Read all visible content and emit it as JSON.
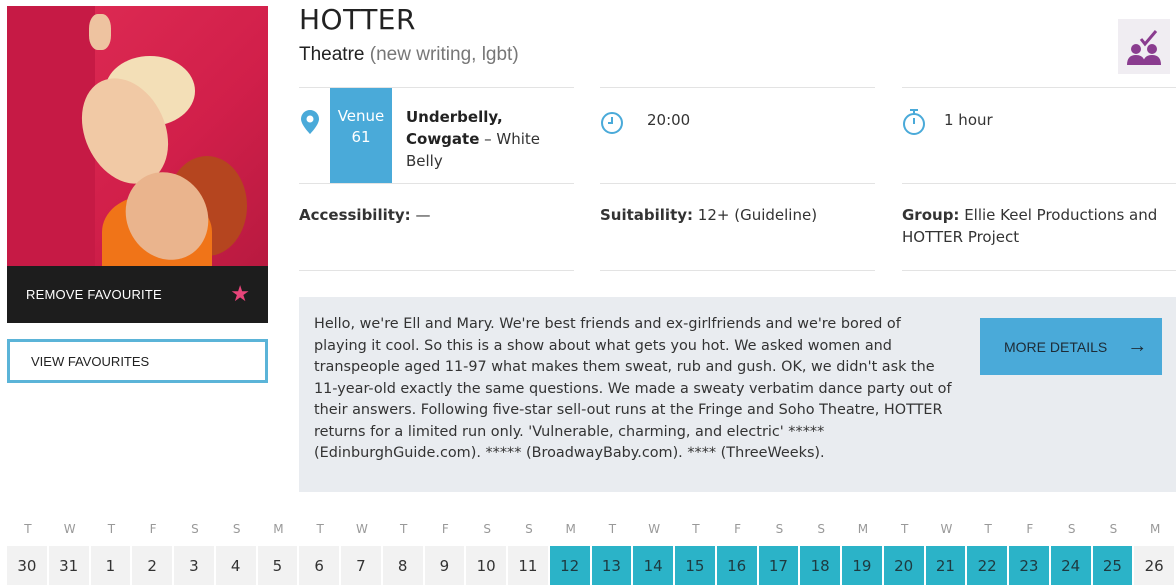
{
  "show": {
    "title": "HOTTER",
    "category": "Theatre",
    "genres": "(new writing, lgbt)"
  },
  "sidebar": {
    "remove_favourite_label": "REMOVE FAVOURITE",
    "view_favourites_label": "VIEW FAVOURITES"
  },
  "icons": {
    "location": "map-pin-icon",
    "time": "clock-icon",
    "duration": "stopwatch-icon",
    "favourite": "star-icon",
    "group": "group-check-icon",
    "more": "arrow-right-icon"
  },
  "venue": {
    "badge_line1": "Venue",
    "badge_line2": "61",
    "name_bold": "Underbelly, Cowgate",
    "name_rest": " – White Belly"
  },
  "time": "20:00",
  "duration": "1 hour",
  "accessibility": {
    "label": "Accessibility:",
    "value": " —"
  },
  "suitability": {
    "label": "Suitability:",
    "value": " 12+ (Guideline)"
  },
  "group": {
    "label": "Group:",
    "value": " Ellie Keel Productions and HOTTER Project"
  },
  "description": "Hello, we're Ell and Mary. We're best friends and ex-girlfriends and we're bored of playing it cool. So this is a show about what gets you hot. We asked women and transpeople aged 11-97 what makes them sweat, rub and gush. OK, we didn't ask the 11-year-old exactly the same questions. We made a sweaty verbatim dance party out of their answers. Following five-star sell-out runs at the Fringe and Soho Theatre, HOTTER returns for a limited run only. 'Vulnerable, charming, and electric' ***** (EdinburghGuide.com). ***** (BroadwayBaby.com). **** (ThreeWeeks).",
  "more_details_label": "MORE DETAILS",
  "calendar": {
    "weekdays": [
      "T",
      "W",
      "T",
      "F",
      "S",
      "S",
      "M",
      "T",
      "W",
      "T",
      "F",
      "S",
      "S",
      "M",
      "T",
      "W",
      "T",
      "F",
      "S",
      "S",
      "M",
      "T",
      "W",
      "T",
      "F",
      "S",
      "S",
      "M"
    ],
    "dates": [
      "30",
      "31",
      "1",
      "2",
      "3",
      "4",
      "5",
      "6",
      "7",
      "8",
      "9",
      "10",
      "11",
      "12",
      "13",
      "14",
      "15",
      "16",
      "17",
      "18",
      "19",
      "20",
      "21",
      "22",
      "23",
      "24",
      "25",
      "26"
    ],
    "available": [
      false,
      false,
      false,
      false,
      false,
      false,
      false,
      false,
      false,
      false,
      false,
      false,
      false,
      true,
      true,
      true,
      true,
      true,
      true,
      true,
      true,
      true,
      true,
      true,
      true,
      true,
      true,
      false
    ]
  },
  "colors": {
    "accent_blue": "#4aaad9",
    "available_teal": "#2bb3c8",
    "favourite_pink": "#e8457a",
    "group_purple": "#8a3c8f"
  }
}
